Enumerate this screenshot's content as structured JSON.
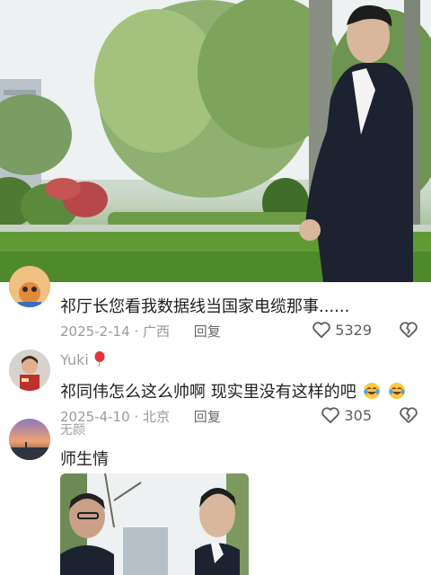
{
  "comments": [
    {
      "username": "",
      "text": "祁厅长您看我数据线当国家电缆那事......",
      "date": "2025-2-14",
      "location": "广西",
      "reply_label": "回复",
      "likes": "5329"
    },
    {
      "username": "Yuki",
      "text": "祁同伟怎么这么帅啊 现实里没有这样的吧",
      "date": "2025-4-10",
      "location": "北京",
      "reply_label": "回复",
      "likes": "305"
    },
    {
      "username": "无颜",
      "text": "师生情"
    }
  ],
  "icons": {
    "like": "heart-outline-icon",
    "dislike": "broken-heart-icon",
    "emoji": "crying-laughing-emoji",
    "username_badge": "red-balloon"
  },
  "colors": {
    "text": "#1e1e1e",
    "meta": "#9a9a9a",
    "username": "#a0a0a0"
  }
}
